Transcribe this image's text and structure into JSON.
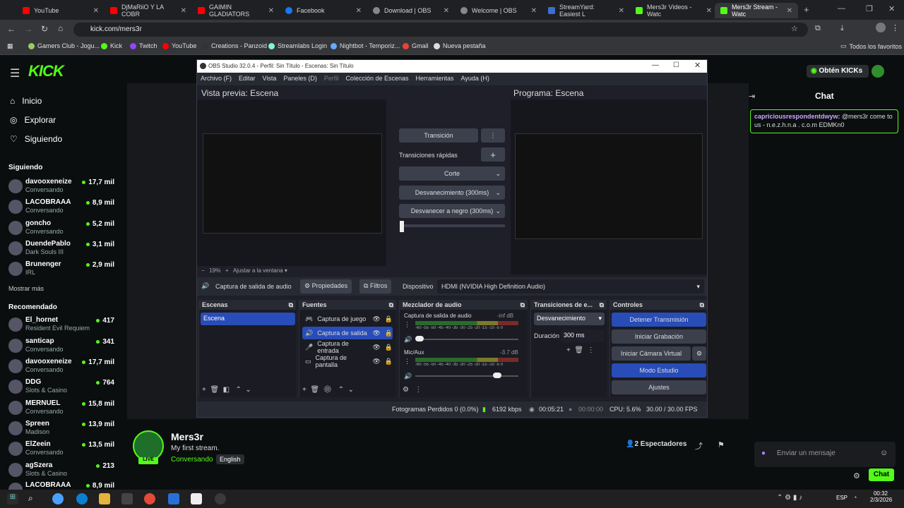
{
  "browser": {
    "tabs": [
      {
        "label": "YouTube",
        "color": "#ff0000"
      },
      {
        "label": "DjMaRiiO Y LA COBR",
        "color": "#ff0000"
      },
      {
        "label": "GAIMIN GLADIATORS",
        "color": "#ff0000"
      },
      {
        "label": "Facebook",
        "color": "#1877f2"
      },
      {
        "label": "Download | OBS",
        "color": "#888888"
      },
      {
        "label": "Welcome | OBS",
        "color": "#888888"
      },
      {
        "label": "StreamYard: Easiest L",
        "color": "#3b6fd1"
      },
      {
        "label": "Mers3r Videos - Watc",
        "color": "#53fc18"
      },
      {
        "label": "Mers3r Stream - Watc",
        "color": "#53fc18"
      }
    ],
    "url": "kick.com/mers3r",
    "bookmarks": [
      "Gamers Club - Jogu...",
      "Kick",
      "Twitch",
      "YouTube",
      "Creations - Panzoid",
      "Streamlabs Login",
      "Nightbot - Temporiz...",
      "Gmail",
      "Nueva pestaña"
    ],
    "all_bookmarks": "Todos los favoritos"
  },
  "kick": {
    "logo": "KICK",
    "login_button": "Obtén KICKs",
    "nav": [
      "Inicio",
      "Explorar",
      "Siguiendo"
    ],
    "following_title": "Siguiendo",
    "following": [
      {
        "name": "davooxeneize",
        "sub": "Conversando",
        "viewers": "17,7 mil"
      },
      {
        "name": "LACOBRAAA",
        "sub": "Conversando",
        "viewers": "8,9 mil"
      },
      {
        "name": "goncho",
        "sub": "Conversando",
        "viewers": "5,2 mil"
      },
      {
        "name": "DuendePablo",
        "sub": "Dark Souls III",
        "viewers": "3,1 mil"
      },
      {
        "name": "Brunenger",
        "sub": "IRL",
        "viewers": "2,9 mil"
      }
    ],
    "show_more": "Mostrar más",
    "recommended_title": "Recomendado",
    "recommended": [
      {
        "name": "El_hornet",
        "sub": "Resident Evil Requiem",
        "viewers": "417"
      },
      {
        "name": "santicap",
        "sub": "Conversando",
        "viewers": "341"
      },
      {
        "name": "davooxeneize",
        "sub": "Conversando",
        "viewers": "17,7 mil"
      },
      {
        "name": "DDG",
        "sub": "Slots & Casino",
        "viewers": "764"
      },
      {
        "name": "MERNUEL",
        "sub": "Conversando",
        "viewers": "15,8 mil"
      },
      {
        "name": "Spreen",
        "sub": "Madison",
        "viewers": "13,9 mil"
      },
      {
        "name": "ElZeein",
        "sub": "Conversando",
        "viewers": "13,5 mil"
      },
      {
        "name": "agSzera",
        "sub": "Slots & Casino",
        "viewers": "213"
      },
      {
        "name": "LACOBRAAA",
        "sub": "",
        "viewers": "8,9 mil"
      }
    ],
    "streamer": {
      "name": "Mers3r",
      "title": "My first stream.",
      "category": "Conversando",
      "language": "English",
      "live": "LIVE"
    },
    "viewers": "2 Espectadores",
    "chat_title": "Chat",
    "chat_message_user": "capriciousrespondentdwyw:",
    "chat_message_text": " @mers3r come to us - n.e.z.h.n.a . c.o.m EDMKn0",
    "chat_placeholder": "Enviar un mensaje",
    "chat_button": "Chat"
  },
  "obs": {
    "title": "OBS Studio 32.0.4 - Perfil: Sin Título - Escenas: Sin Título",
    "menu": [
      "Archivo (F)",
      "Editar",
      "Vista",
      "Paneles (D)",
      "Perfil",
      "Colección de Escenas",
      "Herramientas",
      "Ayuda (H)"
    ],
    "preview_label": "Vista previa: Escena",
    "program_label": "Programa: Escena",
    "transition_button": "Transición",
    "quick_transitions": "Transiciones rápidas",
    "cut": "Corte",
    "fade": "Desvanecimiento (300ms)",
    "fade_black": "Desvanecer a negro (300ms)",
    "zoom": "19%",
    "fit": "Ajustar a la ventana",
    "source_bar_name": "Captura de salida de audio",
    "properties": "Propiedades",
    "filters": "Filtros",
    "device_label": "Dispositivo",
    "device_value": "HDMI (NVIDIA High Definition Audio)",
    "scenes_title": "Escenas",
    "scene": "Escena",
    "sources_title": "Fuentes",
    "sources": [
      "Captura de juego",
      "Captura de salida de",
      "Captura de entrada",
      "Captura de pantalla"
    ],
    "mixer_title": "Mezclador de audio",
    "mixer": [
      {
        "name": "Captura de salida de audio",
        "db": "-inf dB"
      },
      {
        "name": "Mic/Aux",
        "db": "-3.7 dB"
      }
    ],
    "meter_ticks": "-60 -55 -50 -45 -40 -35 -30 -25 -20 -15 -10 -5 0",
    "transitions_title": "Transiciones de e...",
    "transition_select": "Desvanecimiento",
    "duration_label": "Duración",
    "duration_value": "300 ms",
    "controls_title": "Controles",
    "controls": [
      "Detener Transmisión",
      "Iniciar Grabación",
      "Iniciar Cámara Virtual",
      "Modo Estudio",
      "Ajustes"
    ],
    "status": {
      "dropped": "Fotogramas Perdidos 0 (0.0%)",
      "bitrate": "6192 kbps",
      "live_time": "00:05:21",
      "rec_time": "00:00:00",
      "cpu": "CPU: 5.6%",
      "fps": "30.00 / 30.00 FPS"
    }
  },
  "taskbar": {
    "lang": "ESP",
    "time": "00:32",
    "date": "2/3/2026"
  }
}
